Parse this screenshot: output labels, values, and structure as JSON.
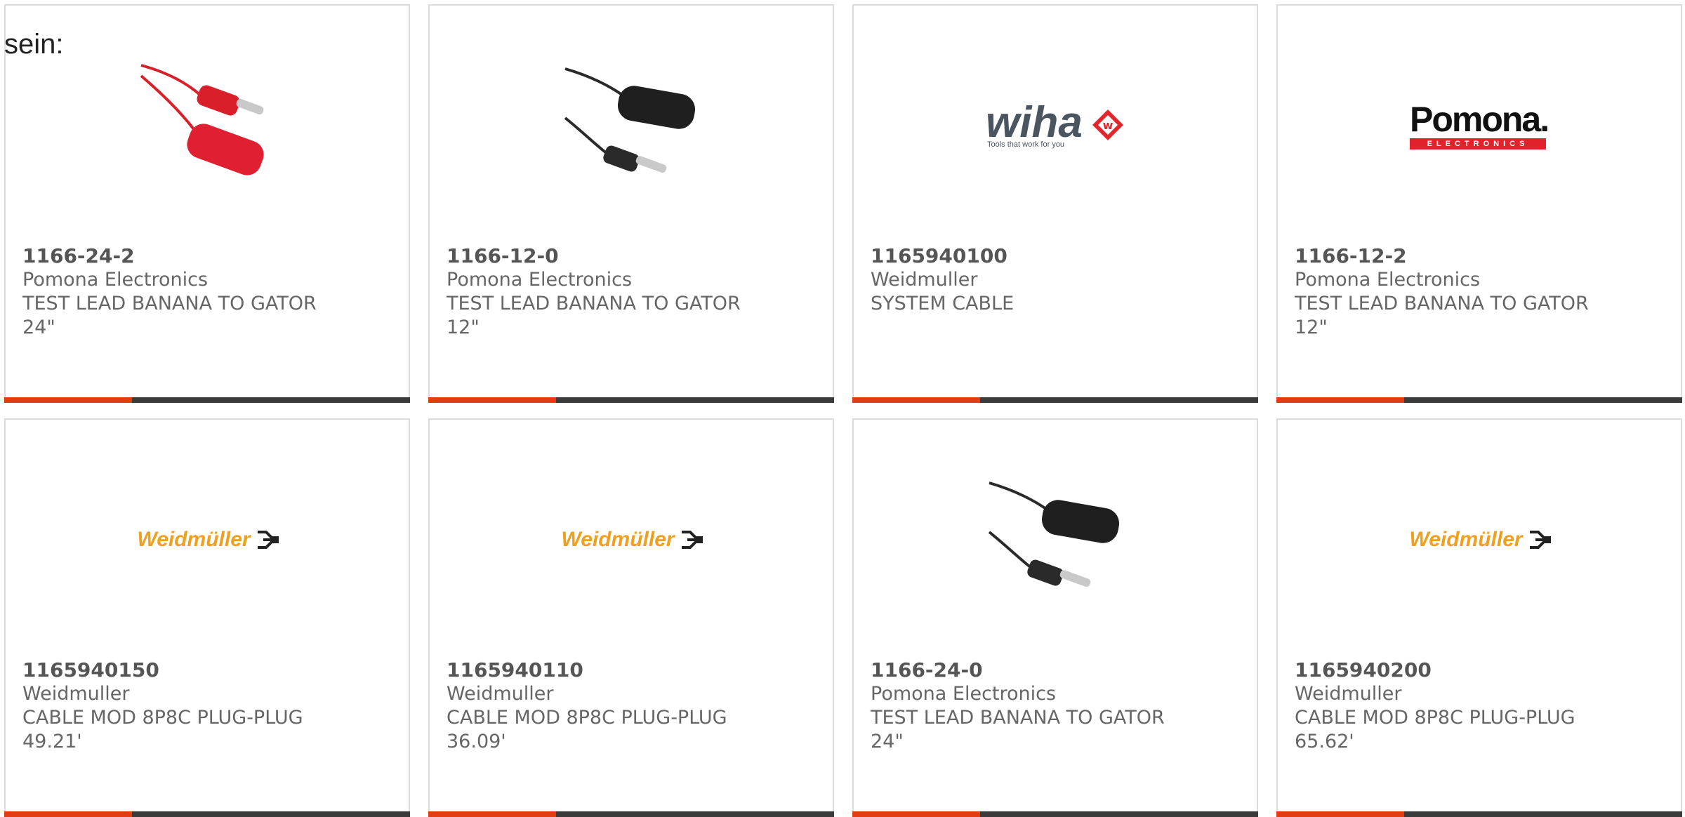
{
  "intro_text": "sein:",
  "products": [
    {
      "part": "1166-24-2",
      "manufacturer": "Pomona Electronics",
      "desc1": "TEST LEAD BANANA TO GATOR",
      "desc2": "24\"",
      "image": "red-test-lead-icon"
    },
    {
      "part": "1166-12-0",
      "manufacturer": "Pomona Electronics",
      "desc1": "TEST LEAD BANANA TO GATOR",
      "desc2": "12\"",
      "image": "black-test-lead-icon"
    },
    {
      "part": "1165940100",
      "manufacturer": "Weidmuller",
      "desc1": "SYSTEM CABLE",
      "desc2": "",
      "image": "wiha-logo",
      "logo_text": "wiha",
      "logo_tagline": "Tools that work for you"
    },
    {
      "part": "1166-12-2",
      "manufacturer": "Pomona Electronics",
      "desc1": "TEST LEAD BANANA TO GATOR",
      "desc2": "12\"",
      "image": "pomona-logo",
      "logo_text": "Pomona.",
      "logo_tagline": "ELECTRONICS"
    },
    {
      "part": "1165940150",
      "manufacturer": "Weidmuller",
      "desc1": "CABLE MOD 8P8C PLUG-PLUG",
      "desc2": "49.21'",
      "image": "weidmuller-logo",
      "logo_text": "Weidmüller"
    },
    {
      "part": "1165940110",
      "manufacturer": "Weidmuller",
      "desc1": "CABLE MOD 8P8C PLUG-PLUG",
      "desc2": "36.09'",
      "image": "weidmuller-logo",
      "logo_text": "Weidmüller"
    },
    {
      "part": "1166-24-0",
      "manufacturer": "Pomona Electronics",
      "desc1": "TEST LEAD BANANA TO GATOR",
      "desc2": "24\"",
      "image": "black-test-lead-icon"
    },
    {
      "part": "1165940200",
      "manufacturer": "Weidmuller",
      "desc1": "CABLE MOD 8P8C PLUG-PLUG",
      "desc2": "65.62'",
      "image": "weidmuller-logo",
      "logo_text": "Weidmüller"
    }
  ],
  "colors": {
    "accent": "#e23c12",
    "bar": "#3b3b3b",
    "red_lead": "#d9202a",
    "black_lead": "#2a2a2a",
    "wiha_gray": "#4a5560",
    "wiha_red": "#e3262b",
    "pomona_red": "#e1212b",
    "weidmuller_orange": "#f0a020"
  }
}
